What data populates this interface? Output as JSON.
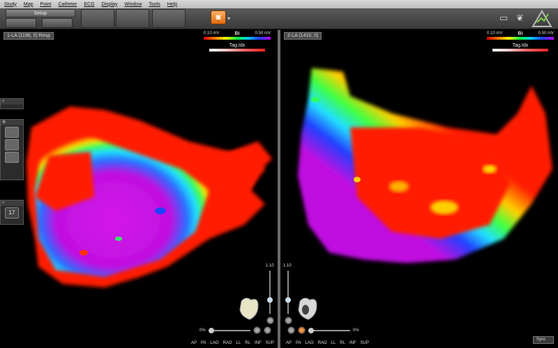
{
  "menu": [
    "Study",
    "Map",
    "Point",
    "Catheter",
    "ECG",
    "Display",
    "Window",
    "Tools",
    "Help"
  ],
  "toolbar": {
    "setup_label": "Setup"
  },
  "left_view": {
    "title": "1-LA (1196, 0) Resp",
    "legend_min": "0.10 mV",
    "legend_mode": "Bi",
    "legend_max": "0.50 mV",
    "tag_label": "Tag.Idx",
    "slider_value": "1.10",
    "opacity": "0%"
  },
  "right_view": {
    "title": "2-LA (1410, 0)",
    "legend_min": "0.10 mV",
    "legend_mode": "Bi",
    "legend_max": "0.50 mV",
    "tag_label": "Tag.Idx",
    "slider_value": "1.10",
    "opacity": "0%"
  },
  "views": [
    "AP",
    "PA",
    "LAO",
    "RAO",
    "LL",
    "RL",
    "INF",
    "SUP"
  ],
  "dock": {
    "calendar_day": "17"
  },
  "sync_label": "Sync"
}
